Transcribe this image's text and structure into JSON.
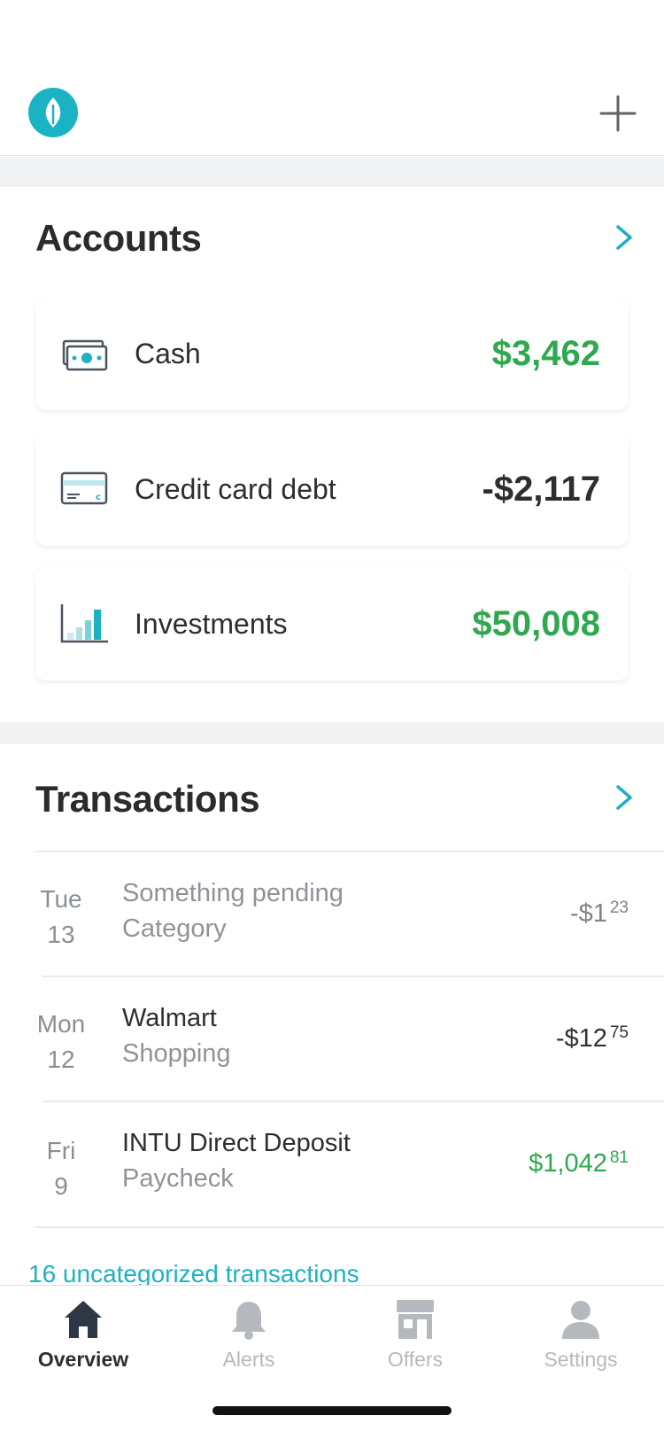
{
  "colors": {
    "accent": "#19b3c4",
    "positive": "#2fa84f",
    "text": "#2e2e2e",
    "muted": "#8f9399"
  },
  "header": {
    "logo_icon": "mint-leaf-icon",
    "add_icon": "plus-icon"
  },
  "accounts": {
    "title": "Accounts",
    "items": [
      {
        "icon": "cash-icon",
        "label": "Cash",
        "value": "$3,462"
      },
      {
        "icon": "credit-card-icon",
        "label": "Credit card debt",
        "value": "-$2,117"
      },
      {
        "icon": "investments-chart-icon",
        "label": "Investments",
        "value": "$50,008"
      }
    ]
  },
  "transactions": {
    "title": "Transactions",
    "items": [
      {
        "dow": "Tue",
        "day": "13",
        "name": "Something pending",
        "category": "Category",
        "amount_main": "-$1",
        "amount_cents": "23",
        "status": "pending"
      },
      {
        "dow": "Mon",
        "day": "12",
        "name": "Walmart",
        "category": "Shopping",
        "amount_main": "-$12",
        "amount_cents": "75",
        "status": "posted"
      },
      {
        "dow": "Fri",
        "day": "9",
        "name": "INTU Direct Deposit",
        "category": "Paycheck",
        "amount_main": "$1,042",
        "amount_cents": "81",
        "status": "income"
      }
    ],
    "uncategorized_link": "16 uncategorized transactions"
  },
  "tabbar": {
    "tabs": [
      {
        "label": "Overview",
        "icon": "home-icon",
        "active": true
      },
      {
        "label": "Alerts",
        "icon": "bell-icon",
        "active": false
      },
      {
        "label": "Offers",
        "icon": "storefront-icon",
        "active": false
      },
      {
        "label": "Settings",
        "icon": "user-icon",
        "active": false
      }
    ]
  }
}
